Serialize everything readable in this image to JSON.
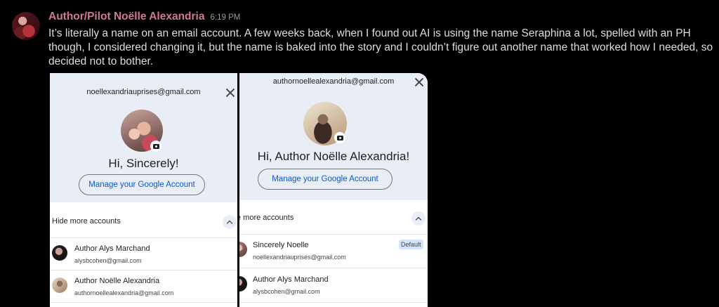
{
  "message": {
    "username": "Author/Pilot Noëlle Alexandria",
    "timestamp": "6:19 PM",
    "text": "It’s literally a name on an email account.  A few weeks back, when I found out AI is using the name Seraphina a lot, spelled with an PH though, I considered changing it, but the name is baked into the story and I couldn’t figure out another name that worked how I needed, so decided not to bother."
  },
  "screenshot_left": {
    "top_email": "noellexandriauprises@gmail.com",
    "greeting": "Hi, Sincerely!",
    "manage_label": "Manage your Google Account",
    "hide_label": "Hide more accounts",
    "accounts": [
      {
        "name": "Author Alys Marchand",
        "email": "alysbcohen@gmail.com"
      },
      {
        "name": "Author Noëlle Alexandria",
        "email": "authornoellealexandria@gmail.com"
      }
    ]
  },
  "screenshot_right": {
    "top_email": "authornoellealexandria@gmail.com",
    "greeting": "Hi, Author Noëlle Alexandria!",
    "manage_label": "Manage your Google Account",
    "hide_label": "e more accounts",
    "accounts": [
      {
        "name": "Sincerely Noelle",
        "email": "noellexandriauprises@gmail.com",
        "badge": "Default"
      },
      {
        "name": "Author Alys Marchand",
        "email": "alysbcohen@gmail.com"
      }
    ]
  },
  "colors": {
    "background": "#000000",
    "username": "#d07995",
    "link_blue": "#0b57d0",
    "header_bg": "#e9eef6"
  }
}
